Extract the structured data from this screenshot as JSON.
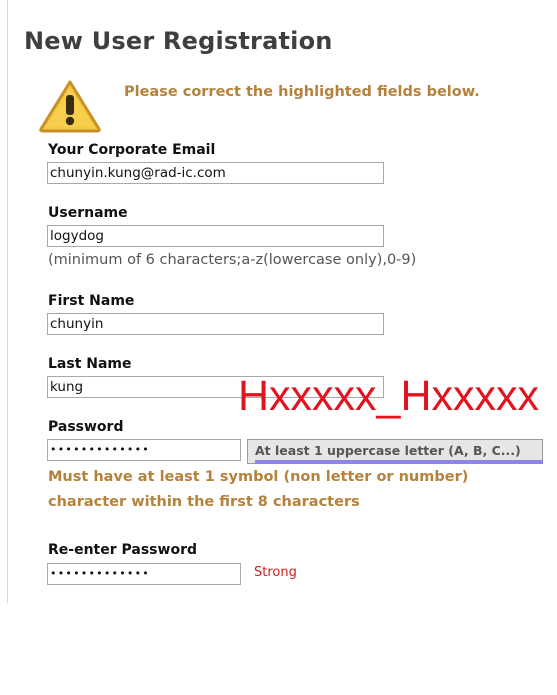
{
  "page": {
    "title": "New User Registration",
    "warning_message": "Please correct the highlighted fields below."
  },
  "form": {
    "email": {
      "label": "Your Corporate Email",
      "value": "chunyin.kung@rad-ic.com"
    },
    "username": {
      "label": "Username",
      "value": "logydog",
      "hint": "(minimum of 6 characters;a-z(lowercase only),0-9)"
    },
    "first_name": {
      "label": "First Name",
      "value": "chunyin"
    },
    "last_name": {
      "label": "Last Name",
      "value": "kung"
    },
    "password": {
      "label": "Password",
      "masked_value": "•••••••••••••",
      "tooltip": "At least 1 uppercase letter (A, B, C...)",
      "error_line1": "Must have at least 1 symbol (non letter or number)",
      "error_line2": "character within the first 8 characters"
    },
    "reenter_password": {
      "label": "Re-enter Password",
      "masked_value": "•••••••••••••",
      "strength": "Strong"
    }
  },
  "overlay": {
    "text": "Hxxxxx_Hxxxxx"
  },
  "colors": {
    "title": "#3f3f3f",
    "warning": "#b5823b",
    "overlay": "#e0141e",
    "strength": "#cc1f1f",
    "tooltip_bar": "#8a85ea",
    "warning_icon_fill": "#f5c842",
    "warning_icon_border": "#c9902a"
  },
  "icons": {
    "warning": "warning-triangle-icon"
  }
}
